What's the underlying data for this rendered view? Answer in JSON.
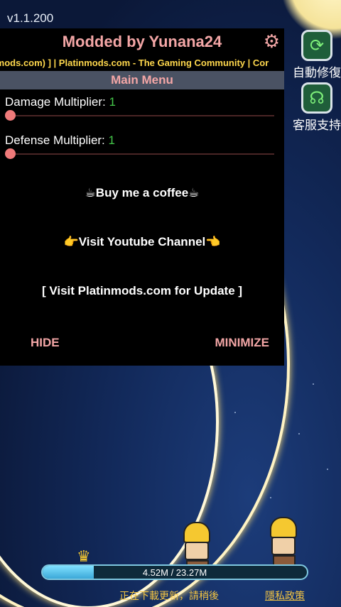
{
  "game": {
    "version": "v1.1.200"
  },
  "side_buttons": [
    {
      "label": "自動修復",
      "icon": "gear-repair-icon"
    },
    {
      "label": "客服支持",
      "icon": "headset-icon"
    }
  ],
  "mod_menu": {
    "title": "Modded by Yunana24",
    "marquee": "platinmods.com) ] | Platinmods.com - The Gaming Community | Cor",
    "section": "Main Menu",
    "sliders": [
      {
        "label": "Damage Multiplier: ",
        "value": "1",
        "level": 0
      },
      {
        "label": "Defense Multiplier: ",
        "value": "1",
        "level": 0
      }
    ],
    "buttons": {
      "coffee": "☕Buy me a coffee☕",
      "youtube": "👉Visit Youtube Channel👈",
      "platinmods": "[ Visit Platinmods.com for Update ]"
    },
    "hide": "HIDE",
    "minimize": "MINIMIZE"
  },
  "download": {
    "progress_text": "4.52M / 23.27M",
    "progress_fraction": 0.194,
    "status": "正在下載更新，請稍後",
    "link": "隱私政策"
  },
  "colors": {
    "menu_accent": "#f3a6a6",
    "marquee": "#ffd84d",
    "slider_value": "#45c84a",
    "status_text": "#f4c542"
  }
}
